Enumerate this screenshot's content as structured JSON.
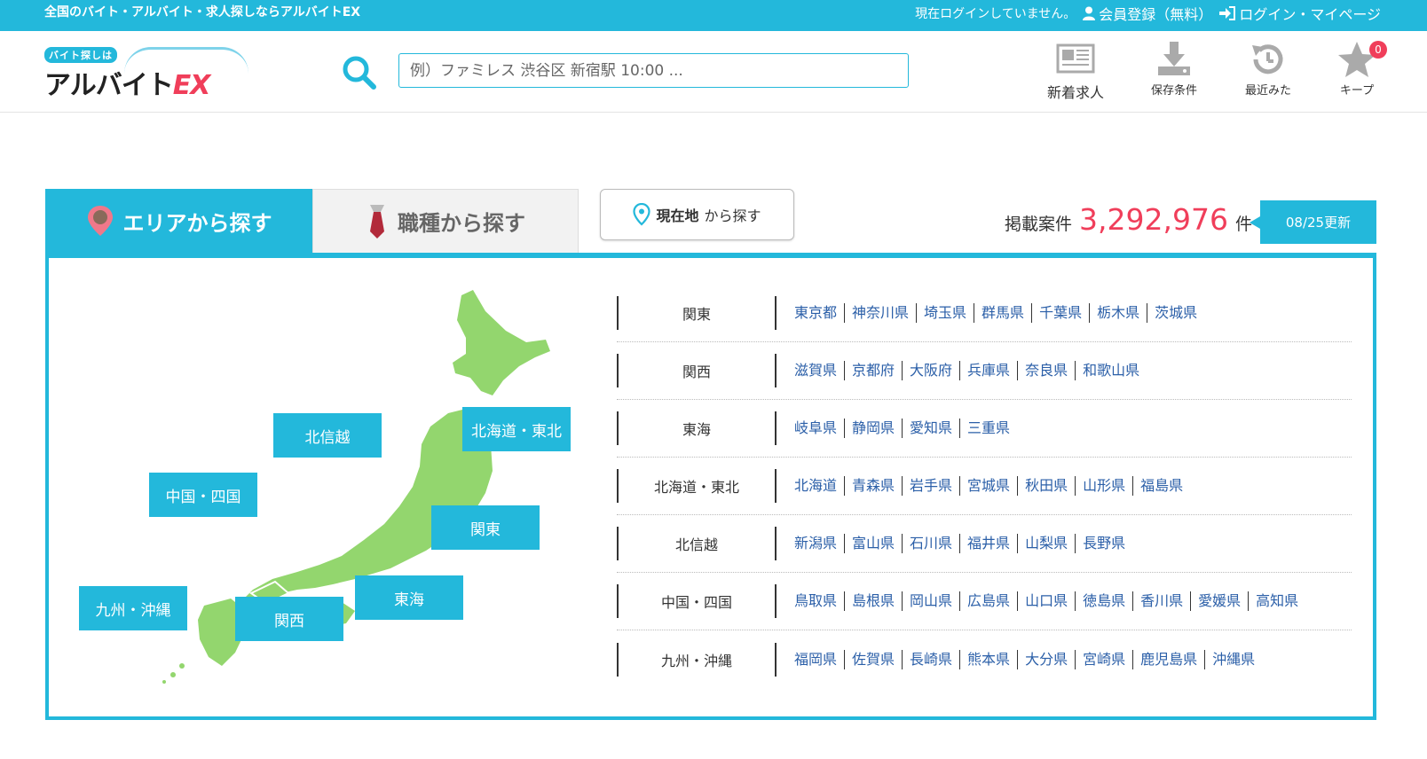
{
  "topbar": {
    "tagline": "全国のバイト・アルバイト・求人探しならアルバイトEX",
    "status": "現在ログインしていません。",
    "register": "会員登録（無料）",
    "login": "ログイン・マイページ"
  },
  "logo": {
    "small": "バイト探しは",
    "main": "アルバイト",
    "ex": "EX"
  },
  "search": {
    "placeholder": "例）ファミレス 渋谷区 新宿駅 10:00 ..."
  },
  "header_nav": {
    "new": "新着求人",
    "saved": "保存条件",
    "recent": "最近みた",
    "keep": "キープ",
    "keep_count": "0"
  },
  "tabs": {
    "area": "エリアから探す",
    "job": "職種から探す"
  },
  "location_button": {
    "bold": "現在地",
    "rest": "から探す"
  },
  "listing": {
    "label": "掲載案件",
    "count": "3,292,976",
    "unit": "件",
    "updated": "08/25更新"
  },
  "map_buttons": {
    "hokushinetsu": "北信越",
    "hokkaido_tohoku": "北海道・東北",
    "chugoku_shikoku": "中国・四国",
    "kanto": "関東",
    "tokai": "東海",
    "kyushu": "九州・沖縄",
    "kansai": "関西"
  },
  "regions": [
    {
      "name": "関東",
      "prefs": [
        "東京都",
        "神奈川県",
        "埼玉県",
        "群馬県",
        "千葉県",
        "栃木県",
        "茨城県"
      ]
    },
    {
      "name": "関西",
      "prefs": [
        "滋賀県",
        "京都府",
        "大阪府",
        "兵庫県",
        "奈良県",
        "和歌山県"
      ]
    },
    {
      "name": "東海",
      "prefs": [
        "岐阜県",
        "静岡県",
        "愛知県",
        "三重県"
      ]
    },
    {
      "name": "北海道・東北",
      "prefs": [
        "北海道",
        "青森県",
        "岩手県",
        "宮城県",
        "秋田県",
        "山形県",
        "福島県"
      ]
    },
    {
      "name": "北信越",
      "prefs": [
        "新潟県",
        "富山県",
        "石川県",
        "福井県",
        "山梨県",
        "長野県"
      ]
    },
    {
      "name": "中国・四国",
      "prefs": [
        "鳥取県",
        "島根県",
        "岡山県",
        "広島県",
        "山口県",
        "徳島県",
        "香川県",
        "愛媛県",
        "高知県"
      ]
    },
    {
      "name": "九州・沖縄",
      "prefs": [
        "福岡県",
        "佐賀県",
        "長崎県",
        "熊本県",
        "大分県",
        "宮崎県",
        "鹿児島県",
        "沖縄県"
      ]
    }
  ],
  "colors": {
    "accent": "#23b8db",
    "count": "#f03e5a",
    "map": "#93d66e",
    "link": "#2b5fa8"
  }
}
